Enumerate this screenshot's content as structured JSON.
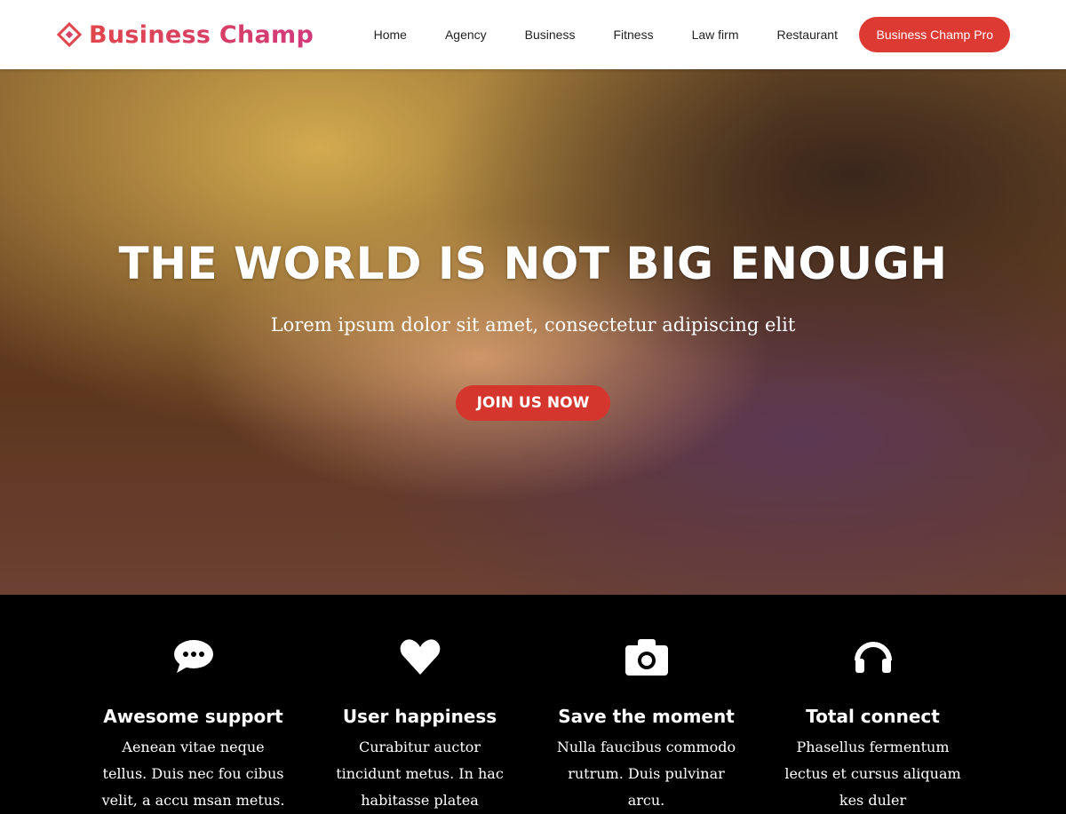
{
  "header": {
    "logo": "Business Champ",
    "nav": [
      "Home",
      "Agency",
      "Business",
      "Fitness",
      "Law firm",
      "Restaurant"
    ],
    "pro_button": "Business Champ Pro"
  },
  "hero": {
    "title": "THE WORLD IS NOT BIG ENOUGH",
    "subtitle": "Lorem ipsum dolor sit amet, consectetur adipiscing elit",
    "cta": "JOIN US NOW"
  },
  "features": [
    {
      "icon": "comment-icon",
      "title": "Awesome support",
      "text": "Aenean vitae neque tellus. Duis nec fou cibus velit, a accu msan metus."
    },
    {
      "icon": "heart-icon",
      "title": "User happiness",
      "text": "Curabitur auctor tincidunt metus. In hac habitasse platea"
    },
    {
      "icon": "camera-icon",
      "title": "Save the moment",
      "text": "Nulla faucibus commodo rutrum. Duis pulvinar arcu."
    },
    {
      "icon": "headphones-icon",
      "title": "Total connect",
      "text": "Phasellus fermentum lectus et cursus aliquam kes duler"
    }
  ]
}
